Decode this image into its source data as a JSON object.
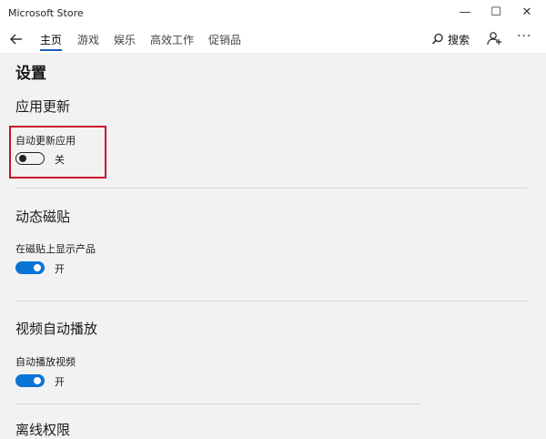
{
  "window": {
    "title": "Microsoft Store",
    "minimize": "—",
    "maximize": "☐",
    "close": "✕"
  },
  "nav": {
    "tabs": [
      {
        "label": "主页",
        "active": true
      },
      {
        "label": "游戏"
      },
      {
        "label": "娱乐"
      },
      {
        "label": "高效工作"
      },
      {
        "label": "促销品"
      }
    ],
    "search_label": "搜索",
    "more": "···"
  },
  "page": {
    "title": "设置",
    "sections": [
      {
        "heading": "应用更新",
        "setting": "自动更新应用",
        "state": "关",
        "on": false
      },
      {
        "heading": "动态磁贴",
        "setting": "在磁贴上显示产品",
        "state": "开",
        "on": true
      },
      {
        "heading": "视频自动播放",
        "setting": "自动播放视频",
        "state": "开",
        "on": true
      },
      {
        "heading": "离线权限"
      }
    ]
  },
  "colors": {
    "accent": "#0a73d6",
    "highlight_box": "#c8102e"
  }
}
